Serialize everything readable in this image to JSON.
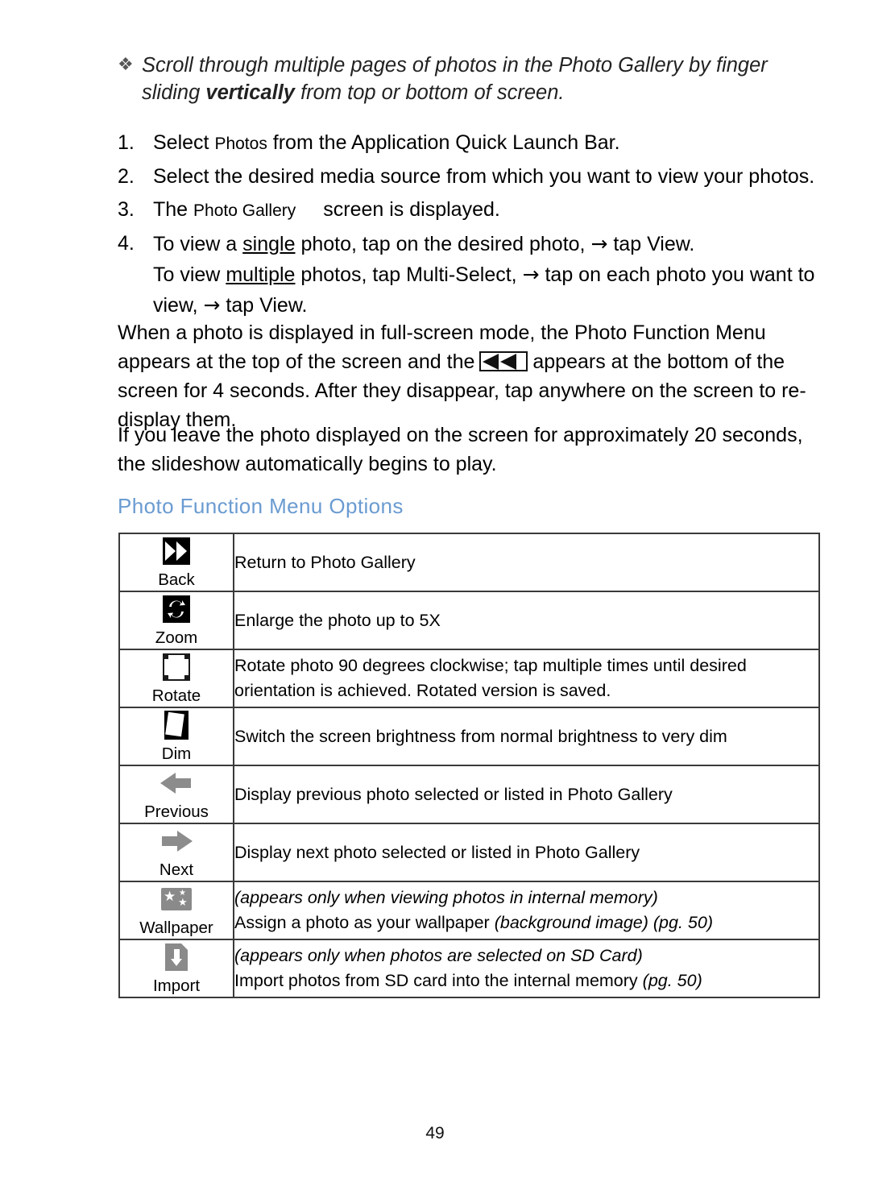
{
  "document": {
    "page_number": "49",
    "accent_color": "#6a9bd1"
  },
  "bullet_note": {
    "marker": "❖",
    "line1_a": "Scroll through multiple pages of photos in the Photo Gallery by finger sliding ",
    "line2_bold": "vertically",
    "line2_rest": " from top or bottom of screen."
  },
  "steps": [
    {
      "number": "1.",
      "text_a": "Select ",
      "ui_term": "Photos",
      "text_b": " from the Application Quick Launch Bar."
    },
    {
      "number": "2.",
      "text_a": "Select the desired media source from which you want to view your photos.",
      "ui_term": "",
      "text_b": ""
    },
    {
      "number": "3.",
      "text_a": "The ",
      "ui_term": "Photo Gallery",
      "text_b": "screen is displayed."
    }
  ],
  "step4": {
    "number": "4.",
    "l1_a": "To view a ",
    "l1_underline": "single",
    "l1_b": " photo, tap on the desired photo, ",
    "l1_arrow": "→",
    "l1_c": " tap ",
    "l1_ui": "View",
    "l1_d": ".",
    "l2_a": "To view ",
    "l2_underline": "multiple",
    "l2_b": " photos, tap ",
    "l2_ui": "Multi-Select",
    "l2_c": ", ",
    "l2_arrow": "→",
    "l2_d": " tap on each photo you want to",
    "l3_a": "view, ",
    "l3_arrow": "→",
    "l3_b": " tap ",
    "l3_ui": "View",
    "l3_c": "."
  },
  "paragraphs": {
    "p1_a": "When a photo is displayed in full-screen mode, the Photo Function Menu appears at the top of the screen and the",
    "p1_icon_name": "rewind-bar-icon",
    "p1_b": "appears at the bottom of the screen for 4 seconds. After they disappear, tap anywhere on the screen to re-display them.",
    "p2": "If you leave the photo displayed on the screen for approximately 20 seconds, the slideshow automatically begins to play."
  },
  "section": {
    "heading": "Photo Function Menu Options"
  },
  "options_table": {
    "rows": [
      {
        "icon": "back-icon",
        "caption": "Back",
        "desc_line1": "Return to Photo Gallery",
        "desc_line2": "",
        "line1_italic": false,
        "line2_tail_italic": ""
      },
      {
        "icon": "zoom-icon",
        "caption": "Zoom",
        "desc_line1": "Enlarge the photo up to 5X",
        "desc_line2": "",
        "line1_italic": false,
        "line2_tail_italic": ""
      },
      {
        "icon": "rotate-icon",
        "caption": "Rotate",
        "desc_line1": "Rotate photo 90 degrees clockwise; tap multiple times until desired",
        "desc_line2": "orientation is achieved. Rotated version is saved.",
        "line1_italic": false,
        "line2_tail_italic": ""
      },
      {
        "icon": "dim-icon",
        "caption": "Dim",
        "desc_line1": "Switch the screen brightness from normal brightness to very dim",
        "desc_line2": "",
        "line1_italic": false,
        "line2_tail_italic": ""
      },
      {
        "icon": "previous-arrow-icon",
        "caption": "Previous",
        "desc_line1": "Display previous photo selected or listed in Photo Gallery",
        "desc_line2": "",
        "line1_italic": false,
        "line2_tail_italic": ""
      },
      {
        "icon": "next-arrow-icon",
        "caption": "Next",
        "desc_line1": "Display next photo selected or listed in Photo Gallery",
        "desc_line2": "",
        "line1_italic": false,
        "line2_tail_italic": ""
      },
      {
        "icon": "wallpaper-icon",
        "caption": "Wallpaper",
        "desc_line1": "(appears only when viewing photos in internal memory)",
        "desc_line2": "Assign a photo as your wallpaper ",
        "line1_italic": true,
        "line2_tail_italic": "(background image) (pg. 50)"
      },
      {
        "icon": "import-icon",
        "caption": "Import",
        "desc_line1": "(appears only when photos are selected on SD Card)",
        "desc_line2": "Import photos from SD card into the internal memory ",
        "line1_italic": true,
        "line2_tail_italic": "(pg. 50)"
      }
    ]
  }
}
